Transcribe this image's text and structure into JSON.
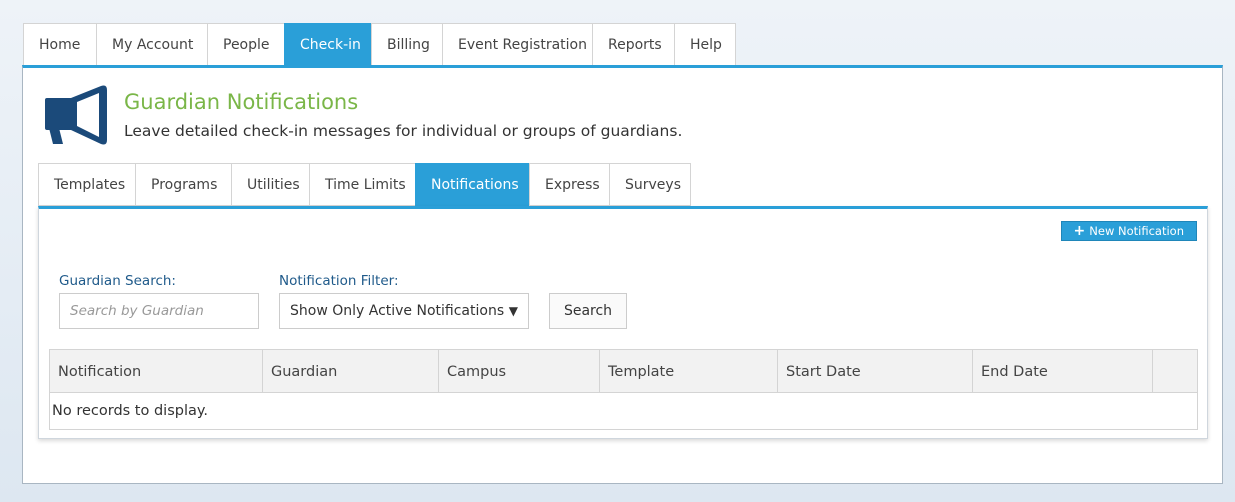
{
  "top_nav": {
    "tabs": [
      {
        "label": "Home"
      },
      {
        "label": "My Account"
      },
      {
        "label": "People"
      },
      {
        "label": "Check-in"
      },
      {
        "label": "Billing"
      },
      {
        "label": "Event Registration"
      },
      {
        "label": "Reports"
      },
      {
        "label": "Help"
      }
    ],
    "active": "Check-in"
  },
  "header": {
    "icon": "megaphone-icon",
    "title": "Guardian Notifications",
    "subtitle": "Leave detailed check-in messages for individual or groups of guardians."
  },
  "sub_nav": {
    "tabs": [
      {
        "label": "Templates"
      },
      {
        "label": "Programs"
      },
      {
        "label": "Utilities"
      },
      {
        "label": "Time Limits"
      },
      {
        "label": "Notifications"
      },
      {
        "label": "Express"
      },
      {
        "label": "Surveys"
      }
    ],
    "active": "Notifications"
  },
  "toolbar": {
    "new_label": "New Notification",
    "new_icon": "plus-icon"
  },
  "filters": {
    "guardian_label": "Guardian Search:",
    "guardian_placeholder": "Search by Guardian",
    "guardian_value": "",
    "filter_label": "Notification Filter:",
    "filter_value": "Show Only Active Notifications",
    "search_label": "Search"
  },
  "grid": {
    "columns": [
      "Notification",
      "Guardian",
      "Campus",
      "Template",
      "Start Date",
      "End Date",
      ""
    ],
    "empty_message": "No records to display."
  },
  "colors": {
    "accent": "#2a9fd8",
    "title_green": "#7ab648",
    "icon_navy": "#1b4a7a",
    "label_blue": "#1f5a8a"
  }
}
